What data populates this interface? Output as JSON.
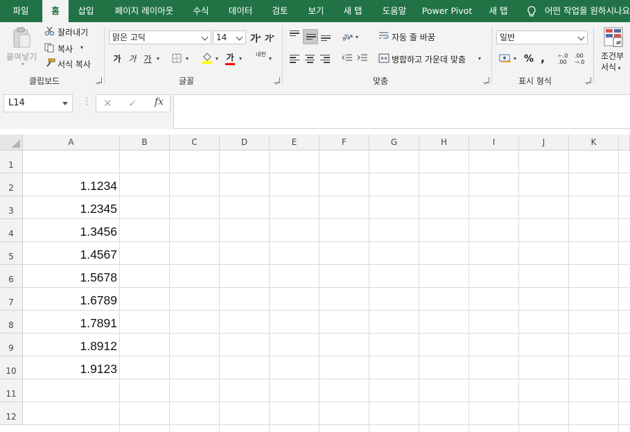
{
  "tabs": [
    {
      "label": "파일",
      "active": false
    },
    {
      "label": "홈",
      "active": true
    },
    {
      "label": "삽입",
      "active": false
    },
    {
      "label": "페이지 레이아웃",
      "active": false
    },
    {
      "label": "수식",
      "active": false
    },
    {
      "label": "데이터",
      "active": false
    },
    {
      "label": "검토",
      "active": false
    },
    {
      "label": "보기",
      "active": false
    },
    {
      "label": "새 탭",
      "active": false
    },
    {
      "label": "도움말",
      "active": false
    },
    {
      "label": "Power Pivot",
      "active": false
    },
    {
      "label": "새 탭",
      "active": false
    }
  ],
  "tell_me": "어떤 작업을 원하시나요",
  "ribbon": {
    "clipboard": {
      "paste": "붙여넣기",
      "cut": "잘라내기",
      "copy": "복사",
      "format_painter": "서식 복사",
      "label": "클립보드"
    },
    "font": {
      "font_name": "맑은 고딕",
      "font_size": "14",
      "increase": "가",
      "decrease": "가",
      "bold": "가",
      "italic": "가",
      "underline": "가",
      "font_color": "가",
      "phonetic": "내천",
      "label": "글꼴"
    },
    "alignment": {
      "wrap_text": "자동 줄 바꿈",
      "merge_center": "병합하고 가운데 맞춤",
      "label": "맞춤"
    },
    "number": {
      "format": "일반",
      "percent": "%",
      "comma": ",",
      "inc_decimal": "←.0 .00",
      "dec_decimal": ".00 →.0",
      "label": "표시 형식"
    },
    "styles": {
      "conditional": "조건부",
      "conditional2": "서식"
    }
  },
  "formula_bar": {
    "name_box": "L14",
    "fx": "fx",
    "formula": ""
  },
  "grid": {
    "columns": [
      "A",
      "B",
      "C",
      "D",
      "E",
      "F",
      "G",
      "H",
      "I",
      "J",
      "K"
    ],
    "rows": [
      "1",
      "2",
      "3",
      "4",
      "5",
      "6",
      "7",
      "8",
      "9",
      "10",
      "11",
      "12"
    ],
    "column_a_values": [
      "",
      "1.1234",
      "1.2345",
      "1.3456",
      "1.4567",
      "1.5678",
      "1.6789",
      "1.7891",
      "1.8912",
      "1.9123",
      "",
      ""
    ]
  },
  "colors": {
    "accent": "#217346",
    "ribbon_bg": "#f3f3f3",
    "highlight_yellow": "#ffff00",
    "font_color_red": "#ff0000"
  }
}
